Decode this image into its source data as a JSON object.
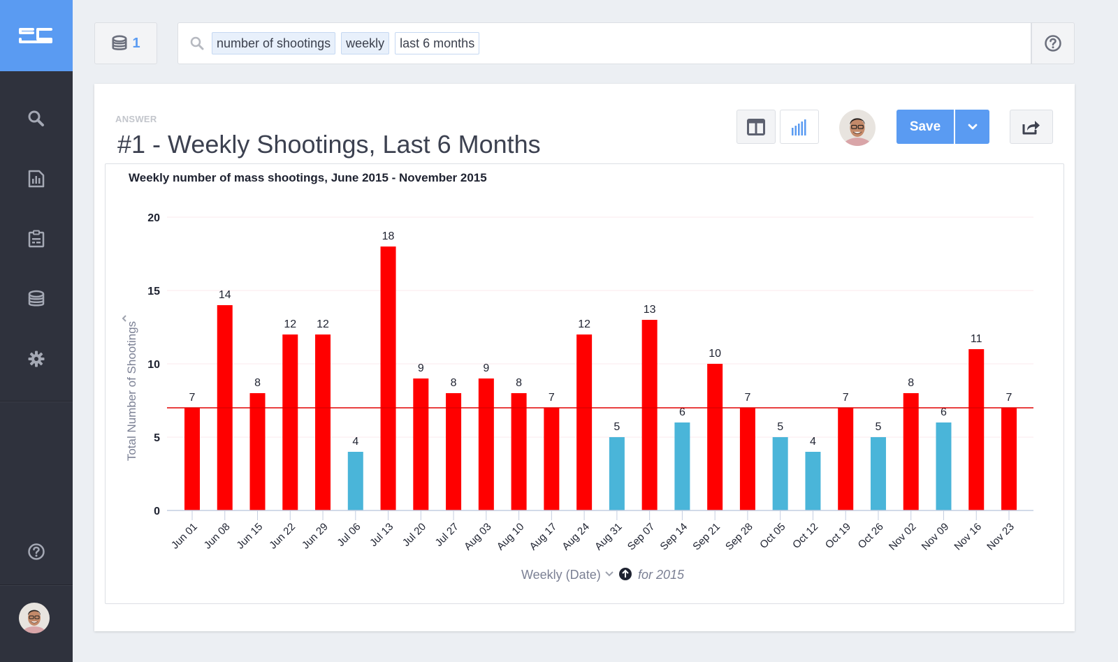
{
  "app": {
    "logo_text": "STS"
  },
  "sidebar": {
    "items": [
      {
        "name": "search",
        "icon": "search-icon"
      },
      {
        "name": "answers",
        "icon": "report-chart-icon"
      },
      {
        "name": "pinboards",
        "icon": "clipboard-icon"
      },
      {
        "name": "data",
        "icon": "database-icon"
      },
      {
        "name": "admin",
        "icon": "gear-icon"
      }
    ],
    "help_icon": "help-icon",
    "avatar": "user-avatar"
  },
  "topbar": {
    "sources_count": "1",
    "search_tokens": [
      {
        "label": "number of shootings",
        "style": "filled"
      },
      {
        "label": "weekly",
        "style": "filled"
      },
      {
        "label": "last 6 months",
        "style": "plain"
      }
    ],
    "help_icon": "help-icon"
  },
  "answer": {
    "label": "ANSWER",
    "title": "#1 - Weekly Shootings, Last 6 Months",
    "save_label": "Save"
  },
  "colors": {
    "accent": "#5a9bf2",
    "above_threshold": "#ff0000",
    "below_threshold": "#4ab5d9",
    "threshold_line": "#e00000"
  },
  "chart_data": {
    "type": "bar",
    "title": "Weekly number of mass shootings, June 2015 - November 2015",
    "xlabel": "Weekly (Date)",
    "xlabel_suffix": "for 2015",
    "ylabel": "Total Number of Shootings",
    "ylim": [
      0,
      20
    ],
    "yticks": [
      0,
      5,
      10,
      15,
      20
    ],
    "grid": true,
    "threshold": 7,
    "categories": [
      "Jun 01",
      "Jun 08",
      "Jun 15",
      "Jun 22",
      "Jun 29",
      "Jul 06",
      "Jul 13",
      "Jul 20",
      "Jul 27",
      "Aug 03",
      "Aug 10",
      "Aug 17",
      "Aug 24",
      "Aug 31",
      "Sep 07",
      "Sep 14",
      "Sep 21",
      "Sep 28",
      "Oct 05",
      "Oct 12",
      "Oct 19",
      "Oct 26",
      "Nov 02",
      "Nov 09",
      "Nov 16",
      "Nov 23"
    ],
    "values": [
      7,
      14,
      8,
      12,
      12,
      4,
      18,
      9,
      8,
      9,
      8,
      7,
      12,
      5,
      13,
      6,
      10,
      7,
      5,
      4,
      7,
      5,
      8,
      6,
      11,
      7
    ]
  }
}
